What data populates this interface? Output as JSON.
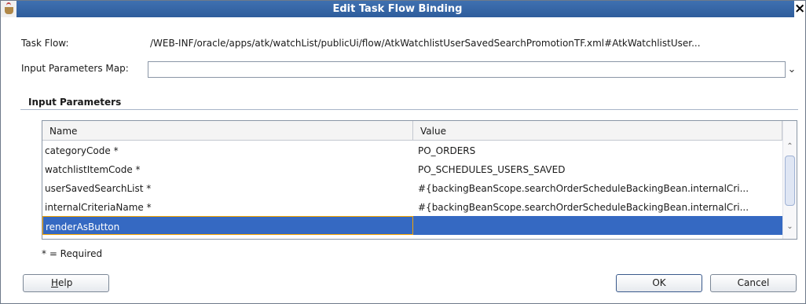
{
  "window": {
    "title": "Edit Task Flow Binding",
    "close_glyph": "×",
    "icon": "java-cup-icon"
  },
  "fields": {
    "task_flow_label": "Task Flow:",
    "task_flow_value": "/WEB-INF/oracle/apps/atk/watchList/publicUi/flow/AtkWatchlistUserSavedSearchPromotionTF.xml#AtkWatchlistUser...",
    "input_map_label": "Input Parameters Map:",
    "input_map_value": ""
  },
  "section": {
    "title": "Input Parameters"
  },
  "table": {
    "columns": [
      "Name",
      "Value"
    ],
    "rows": [
      {
        "name": "categoryCode *",
        "value": "PO_ORDERS"
      },
      {
        "name": "watchlistItemCode *",
        "value": "PO_SCHEDULES_USERS_SAVED"
      },
      {
        "name": "userSavedSearchList *",
        "value": "#{backingBeanScope.searchOrderScheduleBackingBean.internalCri..."
      },
      {
        "name": "internalCriteriaName *",
        "value": "#{backingBeanScope.searchOrderScheduleBackingBean.internalCri..."
      },
      {
        "name": "renderAsButton",
        "value": ""
      }
    ],
    "selected_row": 4
  },
  "required_note": "* = Required",
  "buttons": {
    "help_first": "H",
    "help_rest": "elp",
    "ok": "OK",
    "cancel": "Cancel"
  },
  "colors": {
    "title_bar": "#2e5d9c",
    "selection": "#3569c2",
    "focus_border": "#f6a400"
  }
}
